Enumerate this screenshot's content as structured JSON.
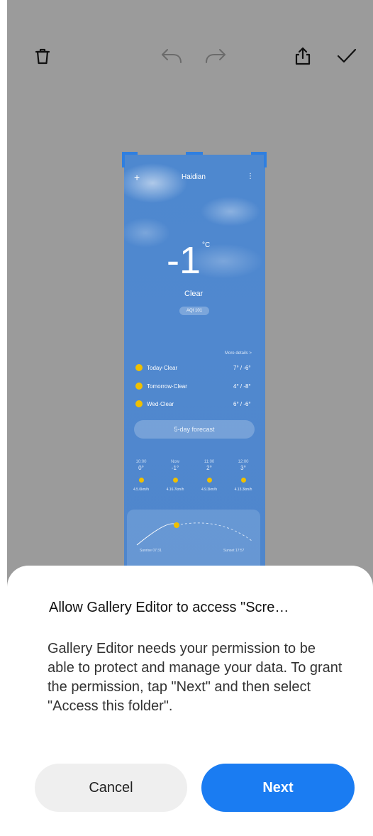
{
  "toolbar": {
    "icons": [
      "delete-icon",
      "undo-icon",
      "redo-icon",
      "share-icon",
      "confirm-icon"
    ]
  },
  "preview": {
    "city": "Haidian",
    "temperature": "-1",
    "unit": "°C",
    "condition": "Clear",
    "aqi": "AQI 101",
    "more_details": "More details >",
    "daily": [
      {
        "label": "Today·Clear",
        "range": "7° / -6°"
      },
      {
        "label": "Tomorrow·Clear",
        "range": "4° / -8°"
      },
      {
        "label": "Wed·Clear",
        "range": "6° / -6°"
      }
    ],
    "forecast_button": "5-day forecast",
    "hourly": [
      {
        "time": "10:00",
        "temp": "0°",
        "wind": "4.5.0km/h"
      },
      {
        "time": "Now",
        "temp": "-1°",
        "wind": "4.16.7km/h"
      },
      {
        "time": "11:00",
        "temp": "2°",
        "wind": "4.9.3km/h"
      },
      {
        "time": "12:00",
        "temp": "3°",
        "wind": "4.13.3km/h"
      }
    ],
    "sunrise": "Sunrise 07:31",
    "sunset": "Sunset 17:57",
    "colors": {
      "sky": "#4f86cc",
      "sun": "#f0c000",
      "crop_handle": "#2f7fe0"
    }
  },
  "dialog": {
    "title": "Allow Gallery Editor to access \"Scre…",
    "body": "Gallery Editor needs your permission to be able to protect and manage your data. To grant the permission, tap \"Next\" and then select \"Access this folder\".",
    "cancel_label": "Cancel",
    "next_label": "Next",
    "colors": {
      "next_bg": "#1a7cf2",
      "cancel_bg": "#efefef"
    }
  }
}
